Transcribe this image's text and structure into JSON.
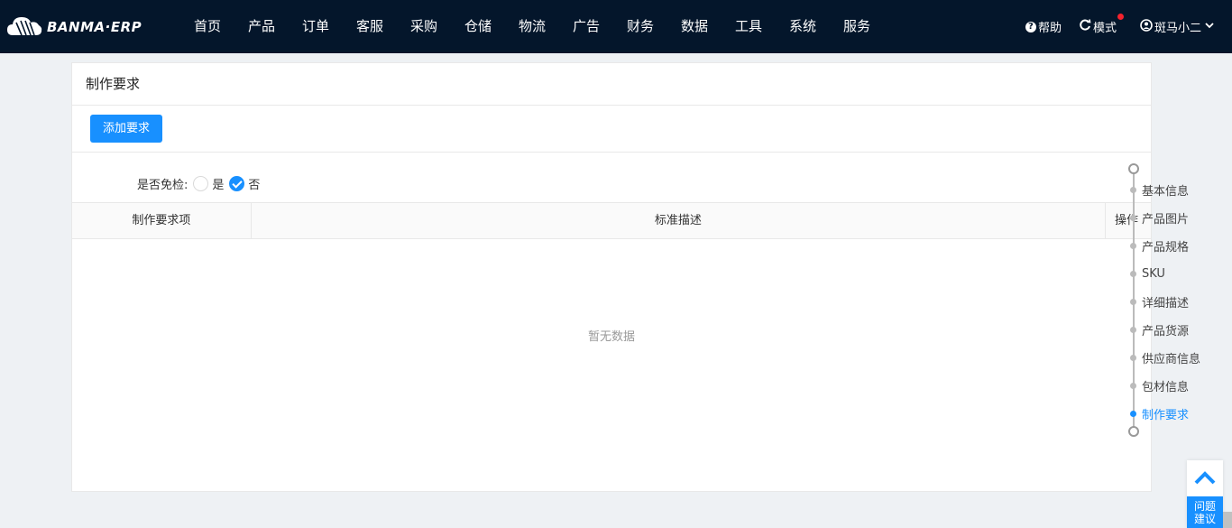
{
  "brand": {
    "name": "BANMA·ERP"
  },
  "nav": {
    "items": [
      "首页",
      "产品",
      "订单",
      "客服",
      "采购",
      "仓储",
      "物流",
      "广告",
      "财务",
      "数据",
      "工具",
      "系统",
      "服务"
    ]
  },
  "tools": {
    "help": "帮助",
    "mode": "模式",
    "user": "斑马小二"
  },
  "card": {
    "title": "制作要求",
    "add_button": "添加要求",
    "exempt": {
      "label": "是否免检:",
      "options": [
        "是",
        "否"
      ],
      "selected": "否"
    },
    "table": {
      "columns": [
        "制作要求项",
        "标准描述",
        "操作"
      ],
      "empty_text": "暂无数据"
    }
  },
  "anchor_nav": {
    "items": [
      "基本信息",
      "产品图片",
      "产品规格",
      "SKU",
      "详细描述",
      "产品货源",
      "供应商信息",
      "包材信息",
      "制作要求"
    ],
    "active": "制作要求"
  },
  "feedback": {
    "line1": "问题",
    "line2": "建议"
  },
  "colors": {
    "topbar": "#04162b",
    "accent": "#1890ff",
    "notify": "#f5222d"
  }
}
